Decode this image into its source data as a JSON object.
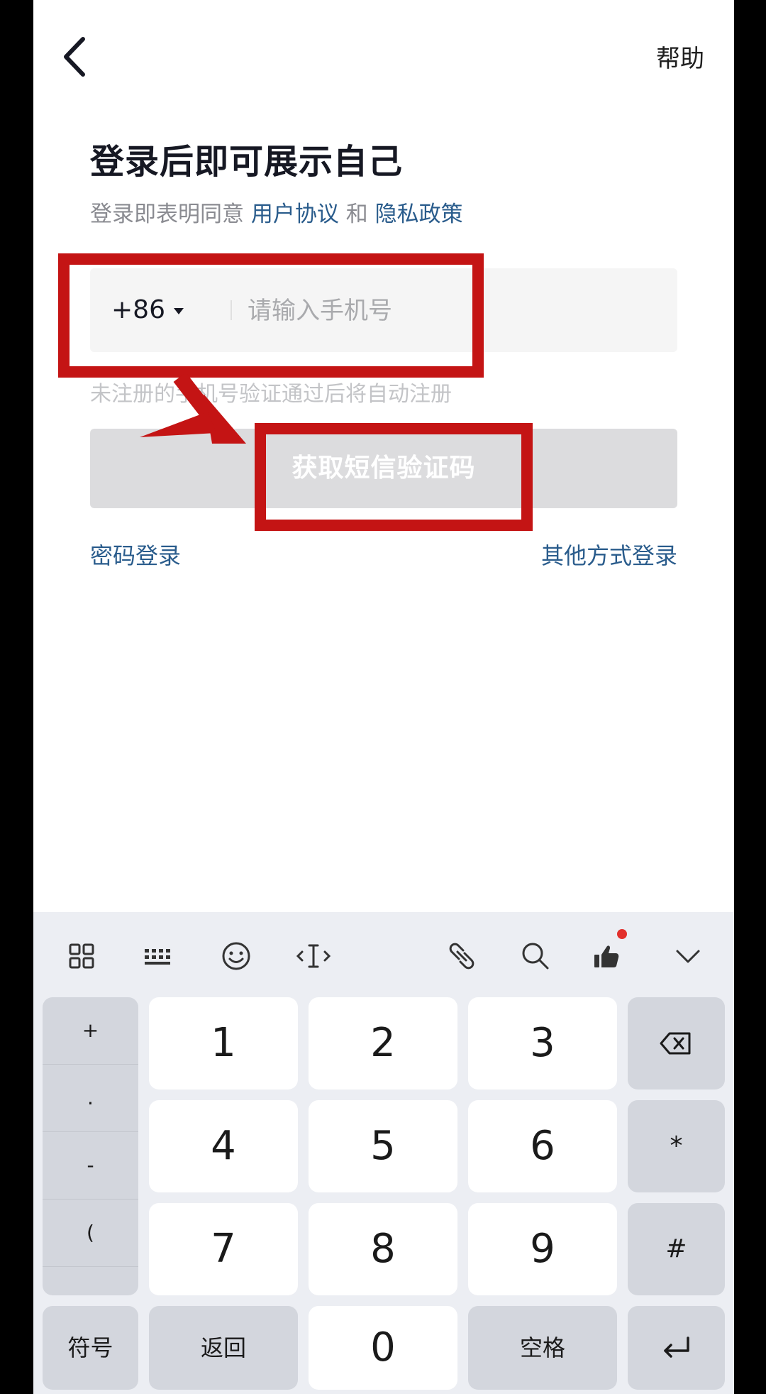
{
  "header": {
    "back_icon": "chevron-left-icon",
    "help_label": "帮助"
  },
  "main": {
    "title": "登录后即可展示自己",
    "agreement_prefix": "登录即表明同意",
    "user_agreement": "用户协议",
    "agreement_and": "和",
    "privacy_policy": "隐私政策",
    "country_code": "+86",
    "phone_placeholder": "请输入手机号",
    "phone_value": "",
    "hint": "未注册的手机号验证通过后将自动注册",
    "sms_button": "获取短信验证码",
    "password_login": "密码登录",
    "other_login": "其他方式登录"
  },
  "colors": {
    "link": "#2a5c8c",
    "disabled_button": "#dcdcde",
    "highlight": "#c41414"
  },
  "keyboard": {
    "toolbar_icons": [
      "grid-icon",
      "keyboard-icon",
      "emoji-icon",
      "cursor-icon",
      "link-icon",
      "search-icon",
      "thumbs-up-icon",
      "chevron-down-icon"
    ],
    "symbols": [
      "+",
      ".",
      "-",
      "(",
      "."
    ],
    "digits": [
      "1",
      "2",
      "3",
      "4",
      "5",
      "6",
      "7",
      "8",
      "9",
      "0"
    ],
    "delete_icon": "backspace-icon",
    "star": "*",
    "hash": "#",
    "symbol_key": "符号",
    "back_key": "返回",
    "space_key": "空格",
    "enter_icon": "enter-icon"
  }
}
